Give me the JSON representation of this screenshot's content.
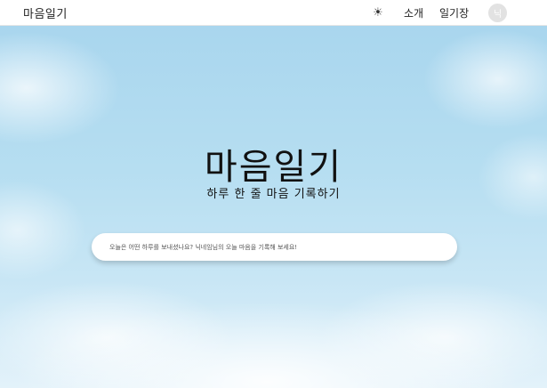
{
  "header": {
    "logo": "마음일기",
    "theme_icon": "sun-icon",
    "theme_glyph": "☀",
    "nav": {
      "about": "소개",
      "diary": "일기장"
    },
    "avatar_initial": "닉"
  },
  "hero": {
    "title": "마음일기",
    "subtitle": "하루 한 줄 마음 기록하기"
  },
  "search": {
    "placeholder": "오늘은 어떤 하루를 보내셨나요? 닉네임님의 오늘 마음을 기록해 보세요!",
    "value": ""
  },
  "colors": {
    "sky": "#b6def1",
    "input_bg": "#ffffff",
    "avatar_bg": "#e2e2e2"
  }
}
